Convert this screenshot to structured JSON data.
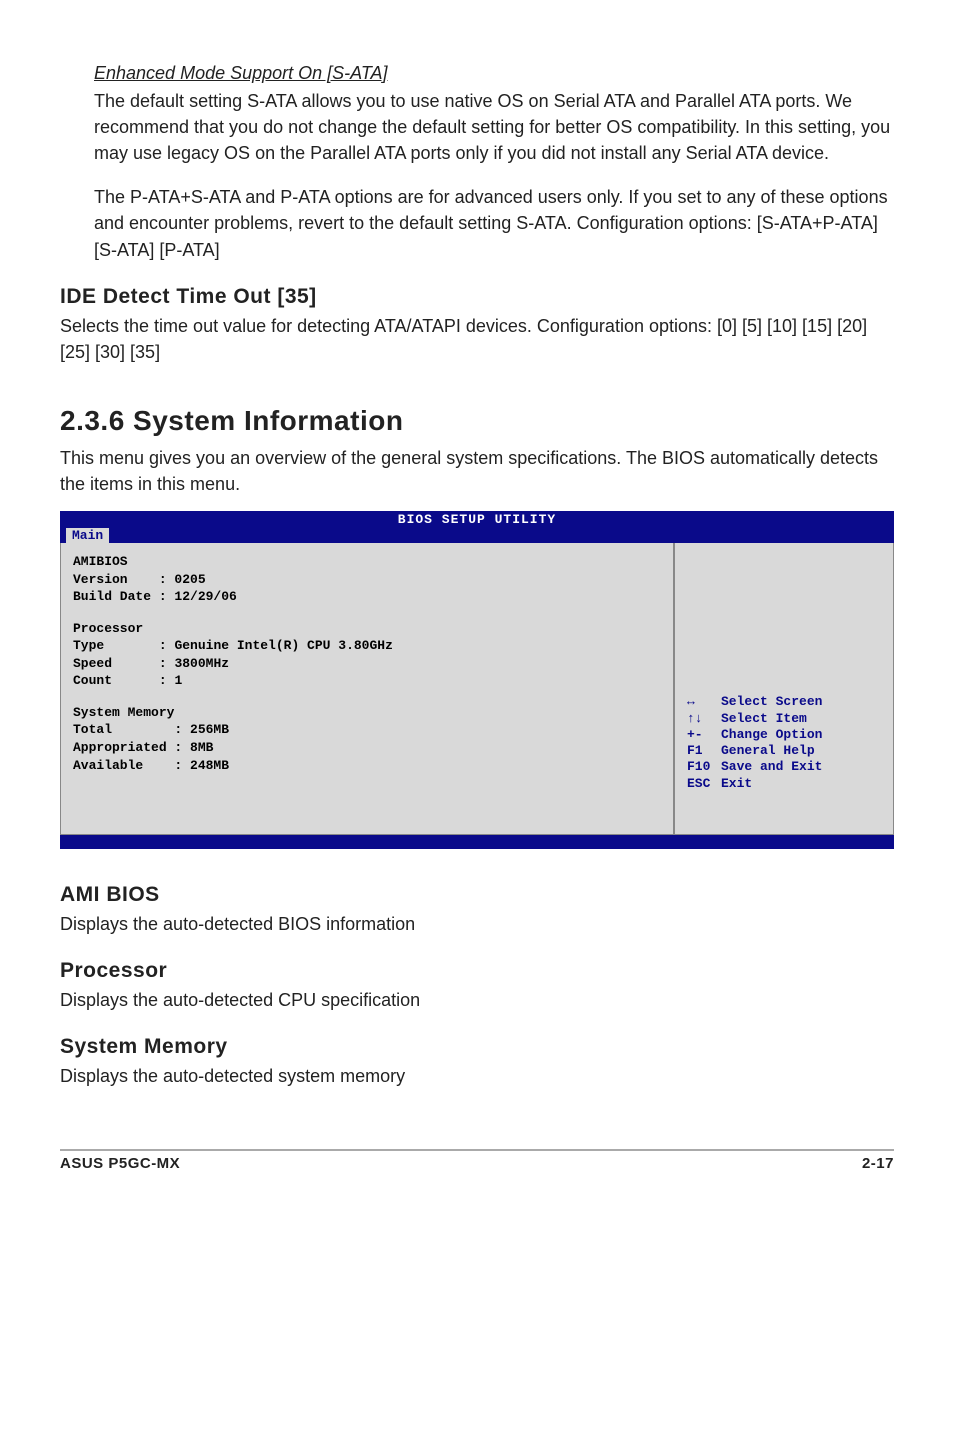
{
  "intro": {
    "enhanced_heading": "Enhanced Mode Support On [S-ATA]",
    "enhanced_p1": "The default setting S-ATA allows you to use native OS on Serial ATA and Parallel ATA ports. We recommend that you do not change the default setting for better OS compatibility. In this setting, you may use legacy OS on the Parallel ATA ports only if you did not install any Serial ATA device.",
    "enhanced_p2": "The P-ATA+S-ATA and P-ATA options are for advanced users only. If you set to any of these options and encounter problems, revert to the default setting S-ATA. Configuration options: [S-ATA+P-ATA] [S-ATA] [P-ATA]"
  },
  "ide": {
    "heading": "IDE Detect Time Out [35]",
    "body": "Selects the time out value for detecting ATA/ATAPI devices. Configuration options: [0] [5] [10] [15] [20] [25] [30] [35]"
  },
  "sysinfo": {
    "heading": "2.3.6   System Information",
    "body": "This menu gives you an overview of the general system specifications. The BIOS automatically detects the items in this menu."
  },
  "bios": {
    "title": "BIOS SETUP UTILITY",
    "tab": "Main",
    "amibios_label": "AMIBIOS",
    "version_label": "Version",
    "version_value": "0205",
    "builddate_label": "Build Date",
    "builddate_value": "12/29/06",
    "processor_label": "Processor",
    "type_label": "Type",
    "type_value": "Genuine Intel(R) CPU 3.80GHz",
    "speed_label": "Speed",
    "speed_value": "3800MHz",
    "count_label": "Count",
    "count_value": "1",
    "sysmem_label": "System Memory",
    "total_label": "Total",
    "total_value": "256MB",
    "approp_label": "Appropriated",
    "approp_value": "8MB",
    "avail_label": "Available",
    "avail_value": "248MB",
    "help": {
      "k1": "↔",
      "v1": "Select Screen",
      "k2": "↑↓",
      "v2": "Select Item",
      "k3": "+-",
      "v3": "Change Option",
      "k4": "F1",
      "v4": "General Help",
      "k5": "F10",
      "v5": "Save and Exit",
      "k6": "ESC",
      "v6": "Exit"
    }
  },
  "sections": {
    "ami_h": "AMI BIOS",
    "ami_p": "Displays the auto-detected BIOS information",
    "proc_h": "Processor",
    "proc_p": "Displays the auto-detected CPU specification",
    "mem_h": "System Memory",
    "mem_p": "Displays the auto-detected system memory"
  },
  "footer": {
    "left": "ASUS P5GC-MX",
    "right": "2-17"
  }
}
